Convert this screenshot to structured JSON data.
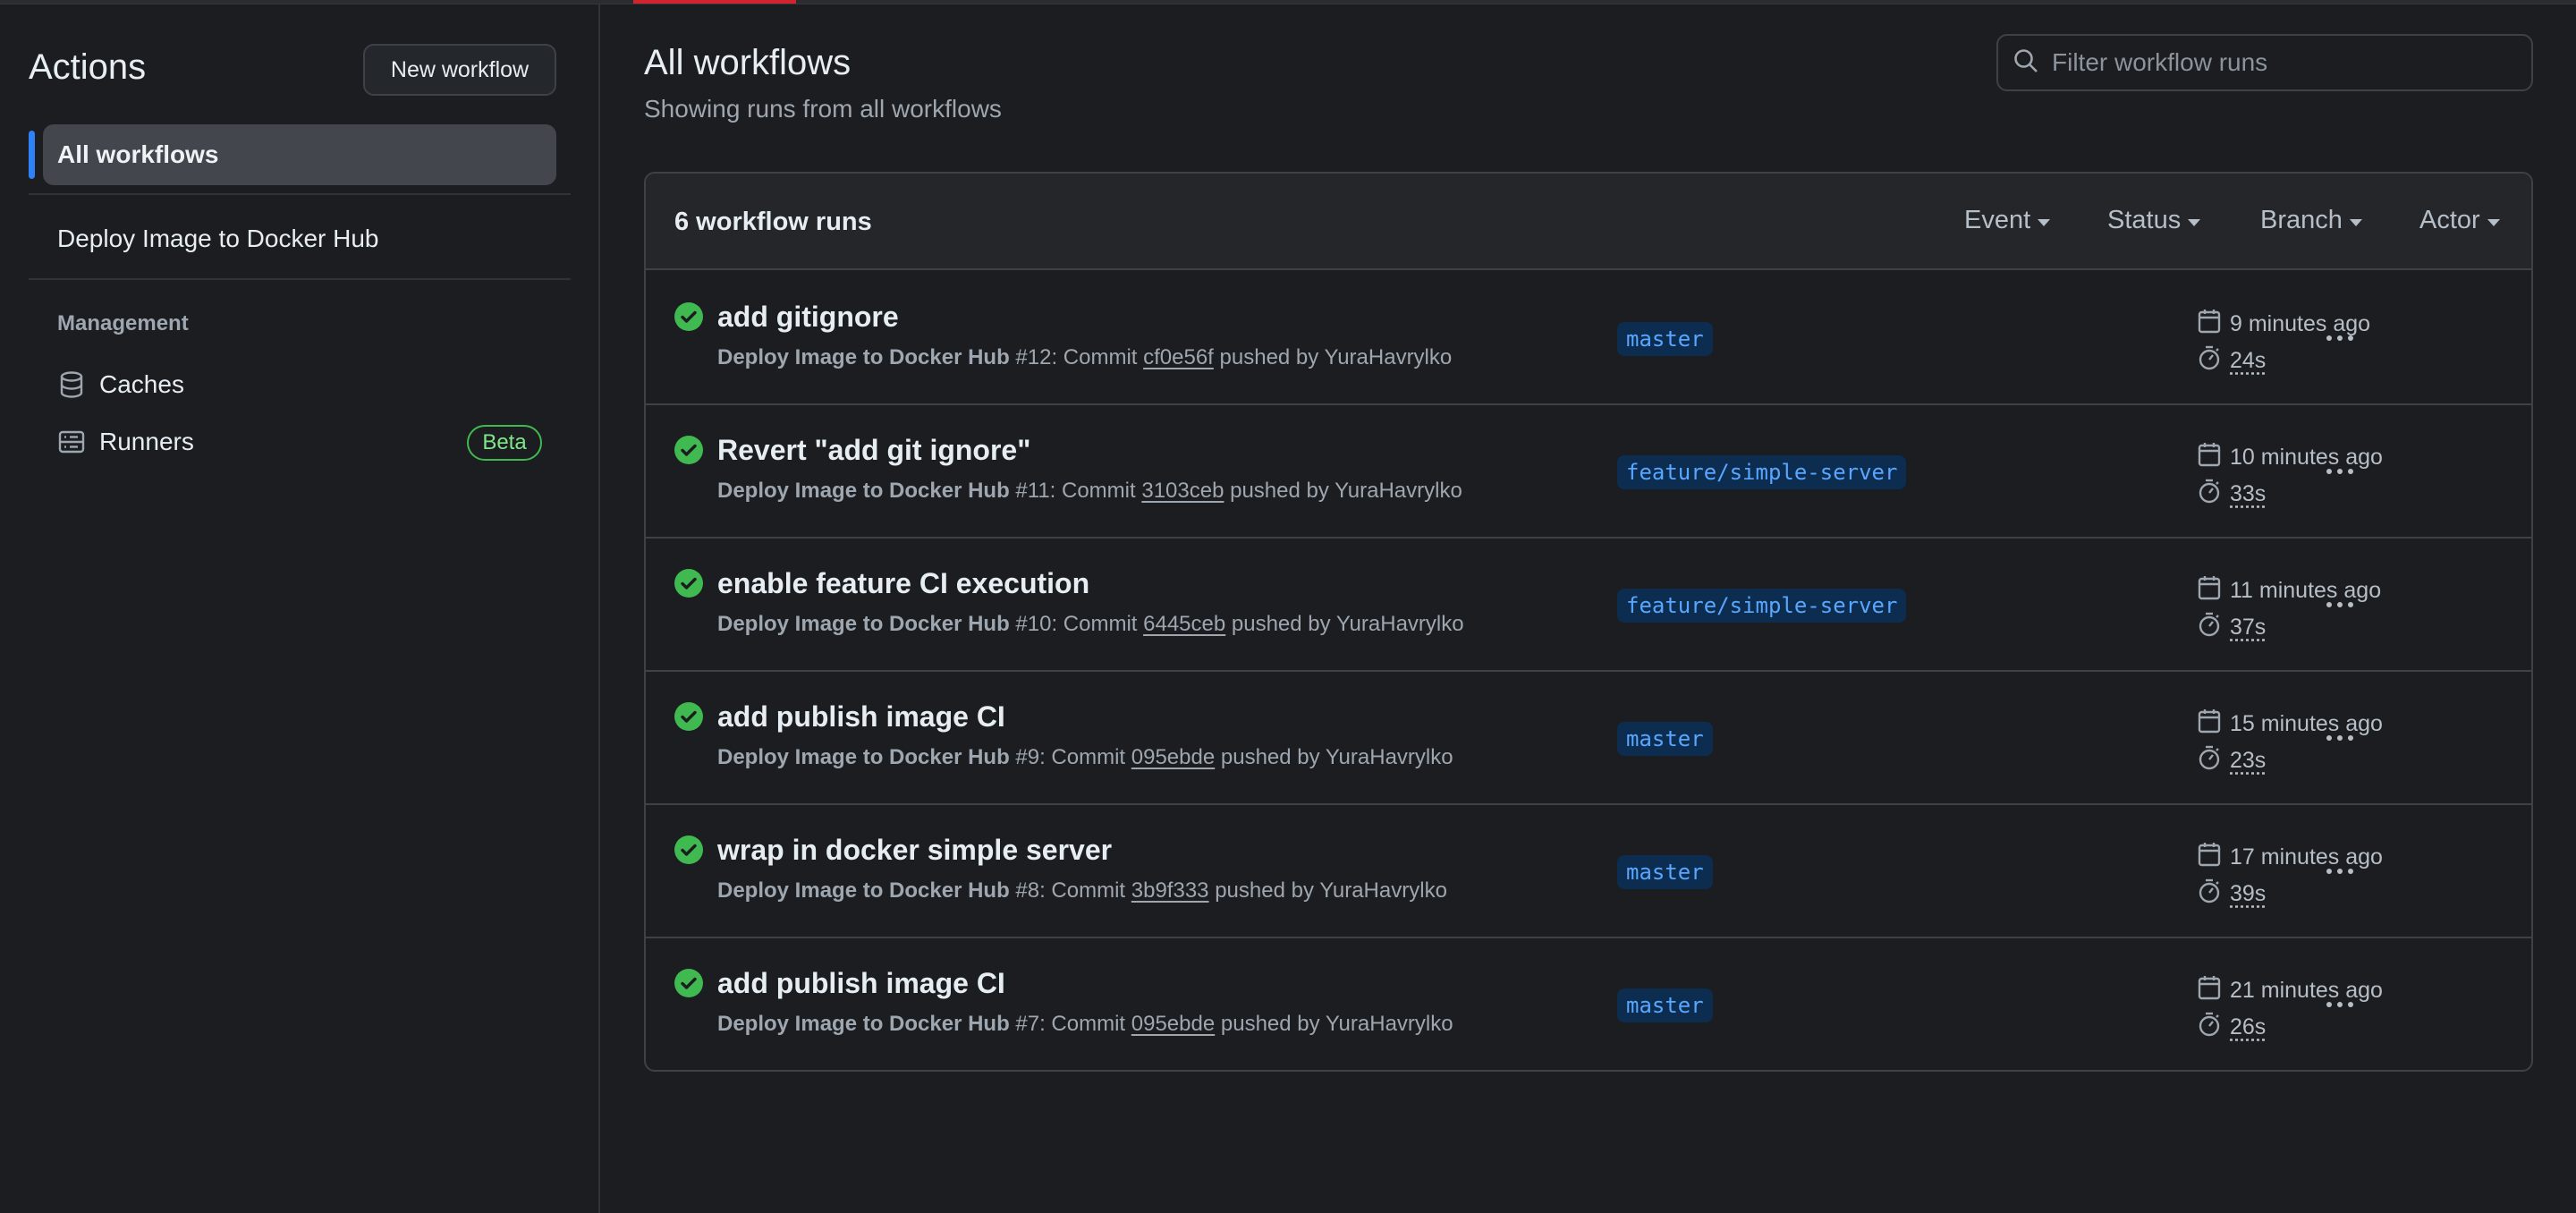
{
  "sidebar": {
    "title": "Actions",
    "new_workflow_label": "New workflow",
    "all_workflows_label": "All workflows",
    "workflows": [
      "Deploy Image to Docker Hub"
    ],
    "management_heading": "Management",
    "caches_label": "Caches",
    "runners_label": "Runners",
    "runners_badge": "Beta"
  },
  "main": {
    "title": "All workflows",
    "subtitle": "Showing runs from all workflows",
    "filter_placeholder": "Filter workflow runs",
    "run_count_label": "6 workflow runs",
    "filters": {
      "event": "Event",
      "status": "Status",
      "branch": "Branch",
      "actor": "Actor"
    },
    "runs": [
      {
        "title": "add gitignore",
        "workflow": "Deploy Image to Docker Hub",
        "number": " #12: Commit ",
        "sha": "cf0e56f",
        "pushed_by": " pushed by YuraHavrylko",
        "branch": "master",
        "time_ago": "9 minutes ago",
        "duration": "24s",
        "status": "success"
      },
      {
        "title": "Revert \"add git ignore\"",
        "workflow": "Deploy Image to Docker Hub",
        "number": " #11: Commit ",
        "sha": "3103ceb",
        "pushed_by": " pushed by YuraHavrylko",
        "branch": "feature/simple-server",
        "time_ago": "10 minutes ago",
        "duration": "33s",
        "status": "success"
      },
      {
        "title": "enable feature CI execution",
        "workflow": "Deploy Image to Docker Hub",
        "number": " #10: Commit ",
        "sha": "6445ceb",
        "pushed_by": " pushed by YuraHavrylko",
        "branch": "feature/simple-server",
        "time_ago": "11 minutes ago",
        "duration": "37s",
        "status": "success"
      },
      {
        "title": "add publish image CI",
        "workflow": "Deploy Image to Docker Hub",
        "number": " #9: Commit ",
        "sha": "095ebde",
        "pushed_by": " pushed by YuraHavrylko",
        "branch": "master",
        "time_ago": "15 minutes ago",
        "duration": "23s",
        "status": "success"
      },
      {
        "title": "wrap in docker simple server",
        "workflow": "Deploy Image to Docker Hub",
        "number": " #8: Commit ",
        "sha": "3b9f333",
        "pushed_by": " pushed by YuraHavrylko",
        "branch": "master",
        "time_ago": "17 minutes ago",
        "duration": "39s",
        "status": "success"
      },
      {
        "title": "add publish image CI",
        "workflow": "Deploy Image to Docker Hub",
        "number": " #7: Commit ",
        "sha": "095ebde",
        "pushed_by": " pushed by YuraHavrylko",
        "branch": "master",
        "time_ago": "21 minutes ago",
        "duration": "26s",
        "status": "success"
      }
    ]
  },
  "colors": {
    "background": "#1c1d20",
    "accent": "#2f81f7",
    "success": "#3fb950",
    "branch_bg": "#0c2d4f",
    "branch_text": "#58a6ff"
  }
}
